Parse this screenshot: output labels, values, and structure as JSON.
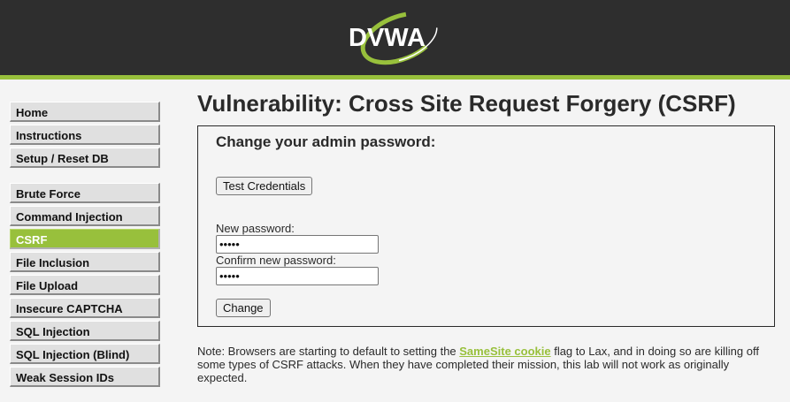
{
  "header": {
    "logo_text": "DVWA",
    "accent_color": "#98c03c",
    "background_color": "#2e2e2e"
  },
  "menu": {
    "groups": [
      [
        "Home",
        "Instructions",
        "Setup / Reset DB"
      ],
      [
        "Brute Force",
        "Command Injection",
        "CSRF",
        "File Inclusion",
        "File Upload",
        "Insecure CAPTCHA",
        "SQL Injection",
        "SQL Injection (Blind)",
        "Weak Session IDs"
      ]
    ],
    "selected": "CSRF",
    "selected_color": "#98c03c"
  },
  "main": {
    "title": "Vulnerability: Cross Site Request Forgery (CSRF)",
    "form": {
      "heading": "Change your admin password:",
      "test_button": "Test Credentials",
      "new_password_label": "New password:",
      "new_password_value": "•••••",
      "confirm_password_label": "Confirm new password:",
      "confirm_password_value": "•••••",
      "change_button": "Change"
    },
    "note": {
      "before": "Note: Browsers are starting to default to setting the ",
      "link": "SameSite cookie",
      "after": " flag to Lax, and in doing so are killing off some types of CSRF attacks. When they have completed their mission, this lab will not work as originally expected."
    }
  }
}
